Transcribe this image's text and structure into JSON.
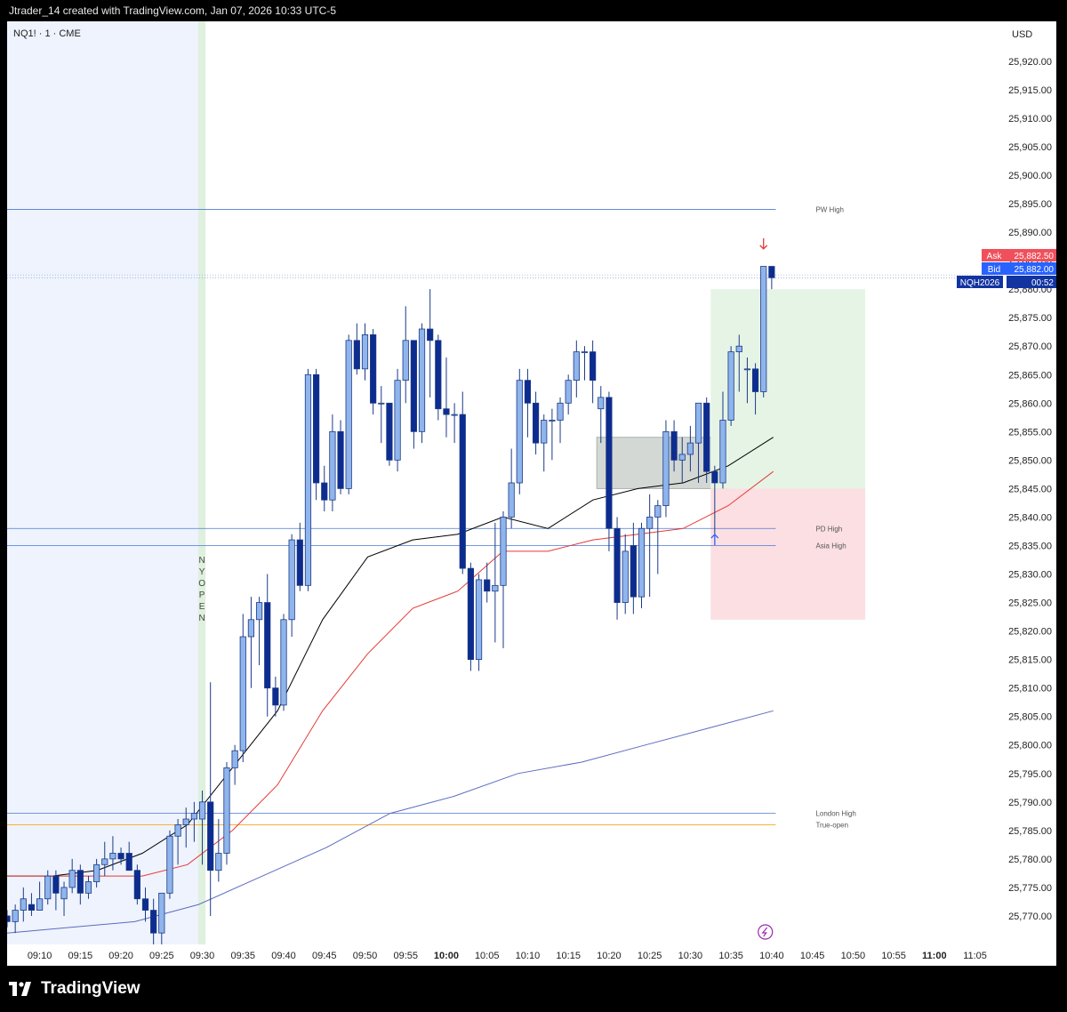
{
  "header": {
    "title": "Jtrader_14 created with TradingView.com, Jan 07, 2026 10:33 UTC-5"
  },
  "footer": {
    "brand": "TradingView"
  },
  "chart_data": {
    "type": "candlestick",
    "symbol_label": "NQ1! · 1 · CME",
    "currency": "USD",
    "ylim": [
      25765,
      25927
    ],
    "y_ticks": [
      25770,
      25775,
      25780,
      25785,
      25790,
      25795,
      25800,
      25805,
      25810,
      25815,
      25820,
      25825,
      25830,
      25835,
      25840,
      25845,
      25850,
      25855,
      25860,
      25865,
      25870,
      25875,
      25880,
      25885,
      25890,
      25895,
      25900,
      25905,
      25910,
      25915,
      25920
    ],
    "y_tick_labels": [
      "25,770.00",
      "25,775.00",
      "25,780.00",
      "25,785.00",
      "25,790.00",
      "25,795.00",
      "25,800.00",
      "25,805.00",
      "25,810.00",
      "25,815.00",
      "25,820.00",
      "25,825.00",
      "25,830.00",
      "25,835.00",
      "25,840.00",
      "25,845.00",
      "25,850.00",
      "25,855.00",
      "25,860.00",
      "25,865.00",
      "25,870.00",
      "25,875.00",
      "25,880.00",
      "25,885.00",
      "25,890.00",
      "25,895.00",
      "25,900.00",
      "25,905.00",
      "25,910.00",
      "25,915.00",
      "25,920.00"
    ],
    "x_ticks": [
      "09:10",
      "09:15",
      "09:20",
      "09:25",
      "09:30",
      "09:35",
      "09:40",
      "09:45",
      "09:50",
      "09:55",
      "10:00",
      "10:05",
      "10:10",
      "10:15",
      "10:20",
      "10:25",
      "10:30",
      "10:35",
      "10:40",
      "10:45",
      "10:50",
      "10:55",
      "11:00",
      "11:05"
    ],
    "x_ticks_bold": [
      "10:00",
      "11:00"
    ],
    "start_time": "09:06",
    "time_range": [
      "09:06",
      "11:08"
    ],
    "candles": [
      {
        "t": "09:06",
        "o": 25770,
        "h": 25771,
        "l": 25768,
        "c": 25769
      },
      {
        "t": "09:07",
        "o": 25769,
        "h": 25772,
        "l": 25767,
        "c": 25771
      },
      {
        "t": "09:08",
        "o": 25771,
        "h": 25775,
        "l": 25769,
        "c": 25773
      },
      {
        "t": "09:09",
        "o": 25772,
        "h": 25774,
        "l": 25770,
        "c": 25771
      },
      {
        "t": "09:10",
        "o": 25771,
        "h": 25776,
        "l": 25771,
        "c": 25773
      },
      {
        "t": "09:11",
        "o": 25773,
        "h": 25778,
        "l": 25772,
        "c": 25777
      },
      {
        "t": "09:12",
        "o": 25777,
        "h": 25778,
        "l": 25771,
        "c": 25774
      },
      {
        "t": "09:13",
        "o": 25773,
        "h": 25776,
        "l": 25770,
        "c": 25775
      },
      {
        "t": "09:14",
        "o": 25775,
        "h": 25780,
        "l": 25774,
        "c": 25778
      },
      {
        "t": "09:15",
        "o": 25778,
        "h": 25779,
        "l": 25772,
        "c": 25774
      },
      {
        "t": "09:16",
        "o": 25774,
        "h": 25777,
        "l": 25773,
        "c": 25776
      },
      {
        "t": "09:17",
        "o": 25776,
        "h": 25780,
        "l": 25775,
        "c": 25779
      },
      {
        "t": "09:18",
        "o": 25779,
        "h": 25783,
        "l": 25777,
        "c": 25780
      },
      {
        "t": "09:19",
        "o": 25780,
        "h": 25784,
        "l": 25778,
        "c": 25781
      },
      {
        "t": "09:20",
        "o": 25781,
        "h": 25782,
        "l": 25779,
        "c": 25780
      },
      {
        "t": "09:21",
        "o": 25781,
        "h": 25783,
        "l": 25779,
        "c": 25778
      },
      {
        "t": "09:22",
        "o": 25778,
        "h": 25779,
        "l": 25772,
        "c": 25773
      },
      {
        "t": "09:23",
        "o": 25773,
        "h": 25775,
        "l": 25769,
        "c": 25771
      },
      {
        "t": "09:24",
        "o": 25771,
        "h": 25773,
        "l": 25765,
        "c": 25767
      },
      {
        "t": "09:25",
        "o": 25767,
        "h": 25774,
        "l": 25765,
        "c": 25774
      },
      {
        "t": "09:26",
        "o": 25774,
        "h": 25785,
        "l": 25773,
        "c": 25784
      },
      {
        "t": "09:27",
        "o": 25784,
        "h": 25787,
        "l": 25779,
        "c": 25786
      },
      {
        "t": "09:28",
        "o": 25786,
        "h": 25789,
        "l": 25782,
        "c": 25787
      },
      {
        "t": "09:29",
        "o": 25787,
        "h": 25790,
        "l": 25783,
        "c": 25788
      },
      {
        "t": "09:30",
        "o": 25787,
        "h": 25792,
        "l": 25779,
        "c": 25790
      },
      {
        "t": "09:31",
        "o": 25790,
        "h": 25811,
        "l": 25770,
        "c": 25778
      },
      {
        "t": "09:32",
        "o": 25778,
        "h": 25787,
        "l": 25776,
        "c": 25781
      },
      {
        "t": "09:33",
        "o": 25781,
        "h": 25797,
        "l": 25779,
        "c": 25796
      },
      {
        "t": "09:34",
        "o": 25796,
        "h": 25800,
        "l": 25793,
        "c": 25799
      },
      {
        "t": "09:35",
        "o": 25799,
        "h": 25823,
        "l": 25797,
        "c": 25819
      },
      {
        "t": "09:36",
        "o": 25819,
        "h": 25826,
        "l": 25810,
        "c": 25822
      },
      {
        "t": "09:37",
        "o": 25822,
        "h": 25826,
        "l": 25814,
        "c": 25825
      },
      {
        "t": "09:38",
        "o": 25825,
        "h": 25830,
        "l": 25805,
        "c": 25810
      },
      {
        "t": "09:39",
        "o": 25810,
        "h": 25812,
        "l": 25805,
        "c": 25807
      },
      {
        "t": "09:40",
        "o": 25807,
        "h": 25823,
        "l": 25806,
        "c": 25822
      },
      {
        "t": "09:41",
        "o": 25822,
        "h": 25837,
        "l": 25819,
        "c": 25836
      },
      {
        "t": "09:42",
        "o": 25836,
        "h": 25839,
        "l": 25827,
        "c": 25828
      },
      {
        "t": "09:43",
        "o": 25828,
        "h": 25866,
        "l": 25827,
        "c": 25865
      },
      {
        "t": "09:44",
        "o": 25865,
        "h": 25866,
        "l": 25843,
        "c": 25846
      },
      {
        "t": "09:45",
        "o": 25846,
        "h": 25849,
        "l": 25841,
        "c": 25843
      },
      {
        "t": "09:46",
        "o": 25843,
        "h": 25858,
        "l": 25841,
        "c": 25855
      },
      {
        "t": "09:47",
        "o": 25855,
        "h": 25857,
        "l": 25844,
        "c": 25845
      },
      {
        "t": "09:48",
        "o": 25845,
        "h": 25872,
        "l": 25844,
        "c": 25871
      },
      {
        "t": "09:49",
        "o": 25871,
        "h": 25874,
        "l": 25865,
        "c": 25866
      },
      {
        "t": "09:50",
        "o": 25866,
        "h": 25874,
        "l": 25864,
        "c": 25872
      },
      {
        "t": "09:51",
        "o": 25872,
        "h": 25873,
        "l": 25858,
        "c": 25860
      },
      {
        "t": "09:52",
        "o": 25860,
        "h": 25863,
        "l": 25853,
        "c": 25860
      },
      {
        "t": "09:53",
        "o": 25860,
        "h": 25860,
        "l": 25849,
        "c": 25850
      },
      {
        "t": "09:54",
        "o": 25850,
        "h": 25866,
        "l": 25848,
        "c": 25864
      },
      {
        "t": "09:55",
        "o": 25864,
        "h": 25877,
        "l": 25860,
        "c": 25871
      },
      {
        "t": "09:56",
        "o": 25871,
        "h": 25871,
        "l": 25852,
        "c": 25855
      },
      {
        "t": "09:57",
        "o": 25855,
        "h": 25874,
        "l": 25853,
        "c": 25873
      },
      {
        "t": "09:58",
        "o": 25873,
        "h": 25880,
        "l": 25861,
        "c": 25871
      },
      {
        "t": "09:59",
        "o": 25871,
        "h": 25872,
        "l": 25857,
        "c": 25859
      },
      {
        "t": "10:00",
        "o": 25859,
        "h": 25868,
        "l": 25854,
        "c": 25858
      },
      {
        "t": "10:01",
        "o": 25858,
        "h": 25860,
        "l": 25853,
        "c": 25858
      },
      {
        "t": "10:02",
        "o": 25858,
        "h": 25862,
        "l": 25830,
        "c": 25831
      },
      {
        "t": "10:03",
        "o": 25831,
        "h": 25832,
        "l": 25813,
        "c": 25815
      },
      {
        "t": "10:04",
        "o": 25815,
        "h": 25830,
        "l": 25813,
        "c": 25829
      },
      {
        "t": "10:05",
        "o": 25829,
        "h": 25832,
        "l": 25825,
        "c": 25827
      },
      {
        "t": "10:06",
        "o": 25827,
        "h": 25839,
        "l": 25818,
        "c": 25828
      },
      {
        "t": "10:07",
        "o": 25828,
        "h": 25841,
        "l": 25817,
        "c": 25840
      },
      {
        "t": "10:08",
        "o": 25840,
        "h": 25852,
        "l": 25838,
        "c": 25846
      },
      {
        "t": "10:09",
        "o": 25846,
        "h": 25866,
        "l": 25844,
        "c": 25864
      },
      {
        "t": "10:10",
        "o": 25864,
        "h": 25866,
        "l": 25854,
        "c": 25860
      },
      {
        "t": "10:11",
        "o": 25860,
        "h": 25862,
        "l": 25851,
        "c": 25853
      },
      {
        "t": "10:12",
        "o": 25853,
        "h": 25858,
        "l": 25848,
        "c": 25857
      },
      {
        "t": "10:13",
        "o": 25857,
        "h": 25859,
        "l": 25850,
        "c": 25857
      },
      {
        "t": "10:14",
        "o": 25857,
        "h": 25861,
        "l": 25853,
        "c": 25860
      },
      {
        "t": "10:15",
        "o": 25860,
        "h": 25865,
        "l": 25858,
        "c": 25864
      },
      {
        "t": "10:16",
        "o": 25864,
        "h": 25871,
        "l": 25861,
        "c": 25869
      },
      {
        "t": "10:17",
        "o": 25869,
        "h": 25870,
        "l": 25864,
        "c": 25869
      },
      {
        "t": "10:18",
        "o": 25869,
        "h": 25871,
        "l": 25860,
        "c": 25864
      },
      {
        "t": "10:19",
        "o": 25859,
        "h": 25863,
        "l": 25853,
        "c": 25861
      },
      {
        "t": "10:20",
        "o": 25861,
        "h": 25862,
        "l": 25834,
        "c": 25838
      },
      {
        "t": "10:21",
        "o": 25838,
        "h": 25840,
        "l": 25822,
        "c": 25825
      },
      {
        "t": "10:22",
        "o": 25825,
        "h": 25837,
        "l": 25823,
        "c": 25834
      },
      {
        "t": "10:23",
        "o": 25835,
        "h": 25839,
        "l": 25823,
        "c": 25826
      },
      {
        "t": "10:24",
        "o": 25826,
        "h": 25839,
        "l": 25824,
        "c": 25838
      },
      {
        "t": "10:25",
        "o": 25838,
        "h": 25844,
        "l": 25826,
        "c": 25840
      },
      {
        "t": "10:26",
        "o": 25840,
        "h": 25843,
        "l": 25830,
        "c": 25842
      },
      {
        "t": "10:27",
        "o": 25842,
        "h": 25857,
        "l": 25840,
        "c": 25855
      },
      {
        "t": "10:28",
        "o": 25855,
        "h": 25857,
        "l": 25848,
        "c": 25850
      },
      {
        "t": "10:29",
        "o": 25850,
        "h": 25854,
        "l": 25846,
        "c": 25851
      },
      {
        "t": "10:30",
        "o": 25851,
        "h": 25856,
        "l": 25848,
        "c": 25853
      },
      {
        "t": "10:31",
        "o": 25853,
        "h": 25860,
        "l": 25846,
        "c": 25860
      },
      {
        "t": "10:32",
        "o": 25860,
        "h": 25861,
        "l": 25846,
        "c": 25848
      },
      {
        "t": "10:33",
        "o": 25848,
        "h": 25849,
        "l": 25837,
        "c": 25846
      },
      {
        "t": "10:34",
        "o": 25846,
        "h": 25862,
        "l": 25845,
        "c": 25857
      },
      {
        "t": "10:35",
        "o": 25857,
        "h": 25870,
        "l": 25856,
        "c": 25869
      },
      {
        "t": "10:36",
        "o": 25869,
        "h": 25872,
        "l": 25862,
        "c": 25870
      },
      {
        "t": "10:37",
        "o": 25866,
        "h": 25868,
        "l": 25860,
        "c": 25866
      },
      {
        "t": "10:38",
        "o": 25866,
        "h": 25867,
        "l": 25858,
        "c": 25862
      },
      {
        "t": "10:39",
        "o": 25862,
        "h": 25884,
        "l": 25861,
        "c": 25884
      },
      {
        "t": "10:40",
        "o": 25884,
        "h": 25884,
        "l": 25880,
        "c": 25882
      }
    ],
    "series": [
      {
        "values": [
          [
            25778.5,
            25777
          ],
          [
            25784,
            25777
          ],
          [
            25794,
            25778
          ],
          [
            25805,
            25781
          ],
          [
            25817,
            25786
          ],
          [
            25836,
            25796
          ],
          [
            25848,
            25806
          ],
          [
            25864,
            25822
          ],
          [
            25873,
            25833
          ],
          [
            25879,
            25836
          ],
          [
            25878,
            25837
          ],
          [
            25885,
            25840
          ],
          [
            25890,
            25838
          ],
          [
            25891,
            25843
          ],
          [
            25895,
            25845
          ],
          [
            25901,
            25846
          ],
          [
            25907,
            25849
          ],
          [
            25910,
            25854
          ]
        ],
        "color": "#000000"
      },
      {
        "values": [
          [
            25777.5,
            25777
          ],
          [
            25782,
            25777
          ],
          [
            25786,
            25777
          ],
          [
            25791,
            25777
          ],
          [
            25795,
            25779
          ],
          [
            25801,
            25785
          ],
          [
            25808,
            25793
          ],
          [
            25820,
            25806
          ],
          [
            25826,
            25816
          ],
          [
            25835,
            25824
          ],
          [
            25839,
            25827
          ],
          [
            25845,
            25834
          ],
          [
            25850,
            25834
          ],
          [
            25852,
            25836
          ],
          [
            25855,
            25837
          ],
          [
            25859,
            25838
          ],
          [
            25864,
            25842
          ],
          [
            25869,
            25848
          ]
        ],
        "color": "#e53935"
      },
      {
        "values": [
          [
            25778,
            25767
          ],
          [
            25781,
            25768
          ],
          [
            25784,
            25769
          ],
          [
            25791,
            25772
          ],
          [
            25800,
            25777
          ],
          [
            25808,
            25782
          ],
          [
            25817,
            25788
          ],
          [
            25827,
            25791
          ],
          [
            25837,
            25795
          ],
          [
            25846,
            25797
          ],
          [
            25857,
            25800
          ],
          [
            25867,
            25803
          ],
          [
            25877,
            25806
          ]
        ],
        "color": "#5c6bc0"
      }
    ],
    "levels": [
      {
        "label": "PW High",
        "value": 25894
      },
      {
        "label": "PD High",
        "value": 25838
      },
      {
        "label": "Asia High",
        "value": 25835
      },
      {
        "label": "London High",
        "value": 25788
      },
      {
        "label": "True-open",
        "value": 25786
      },
      {
        "label": "",
        "value": 25882.5
      },
      {
        "label": "",
        "value": 25882
      }
    ],
    "session_label": "NY OPEN",
    "price_labels": [
      {
        "name": "Ask",
        "value": "25,882.50",
        "color": "#f0505c"
      },
      {
        "name": "Bid",
        "value": "25,882.00",
        "color": "#2962ff"
      },
      {
        "name": "NQH2026",
        "value": "00:52",
        "color": "#1234a0"
      }
    ],
    "zones": [
      {
        "name": "consolidation",
        "t0": "10:19",
        "t1": "10:34",
        "p0": 25845,
        "p1": 25854
      },
      {
        "name": "target",
        "t0": "10:33",
        "t1": "10:51",
        "p0": 25845,
        "p1": 25880
      },
      {
        "name": "stop",
        "t0": "10:33",
        "t1": "10:51",
        "p0": 25822,
        "p1": 25845
      }
    ],
    "markers": [
      {
        "type": "arrow-up",
        "t": "10:33",
        "value": 25836,
        "color": "#2962ff"
      },
      {
        "type": "arrow-down",
        "t": "10:39",
        "value": 25888,
        "color": "#e53935"
      }
    ],
    "colors": {
      "up": "#8fb5ec",
      "down": "#0d2c8f",
      "edge": "#1c3a87"
    }
  }
}
